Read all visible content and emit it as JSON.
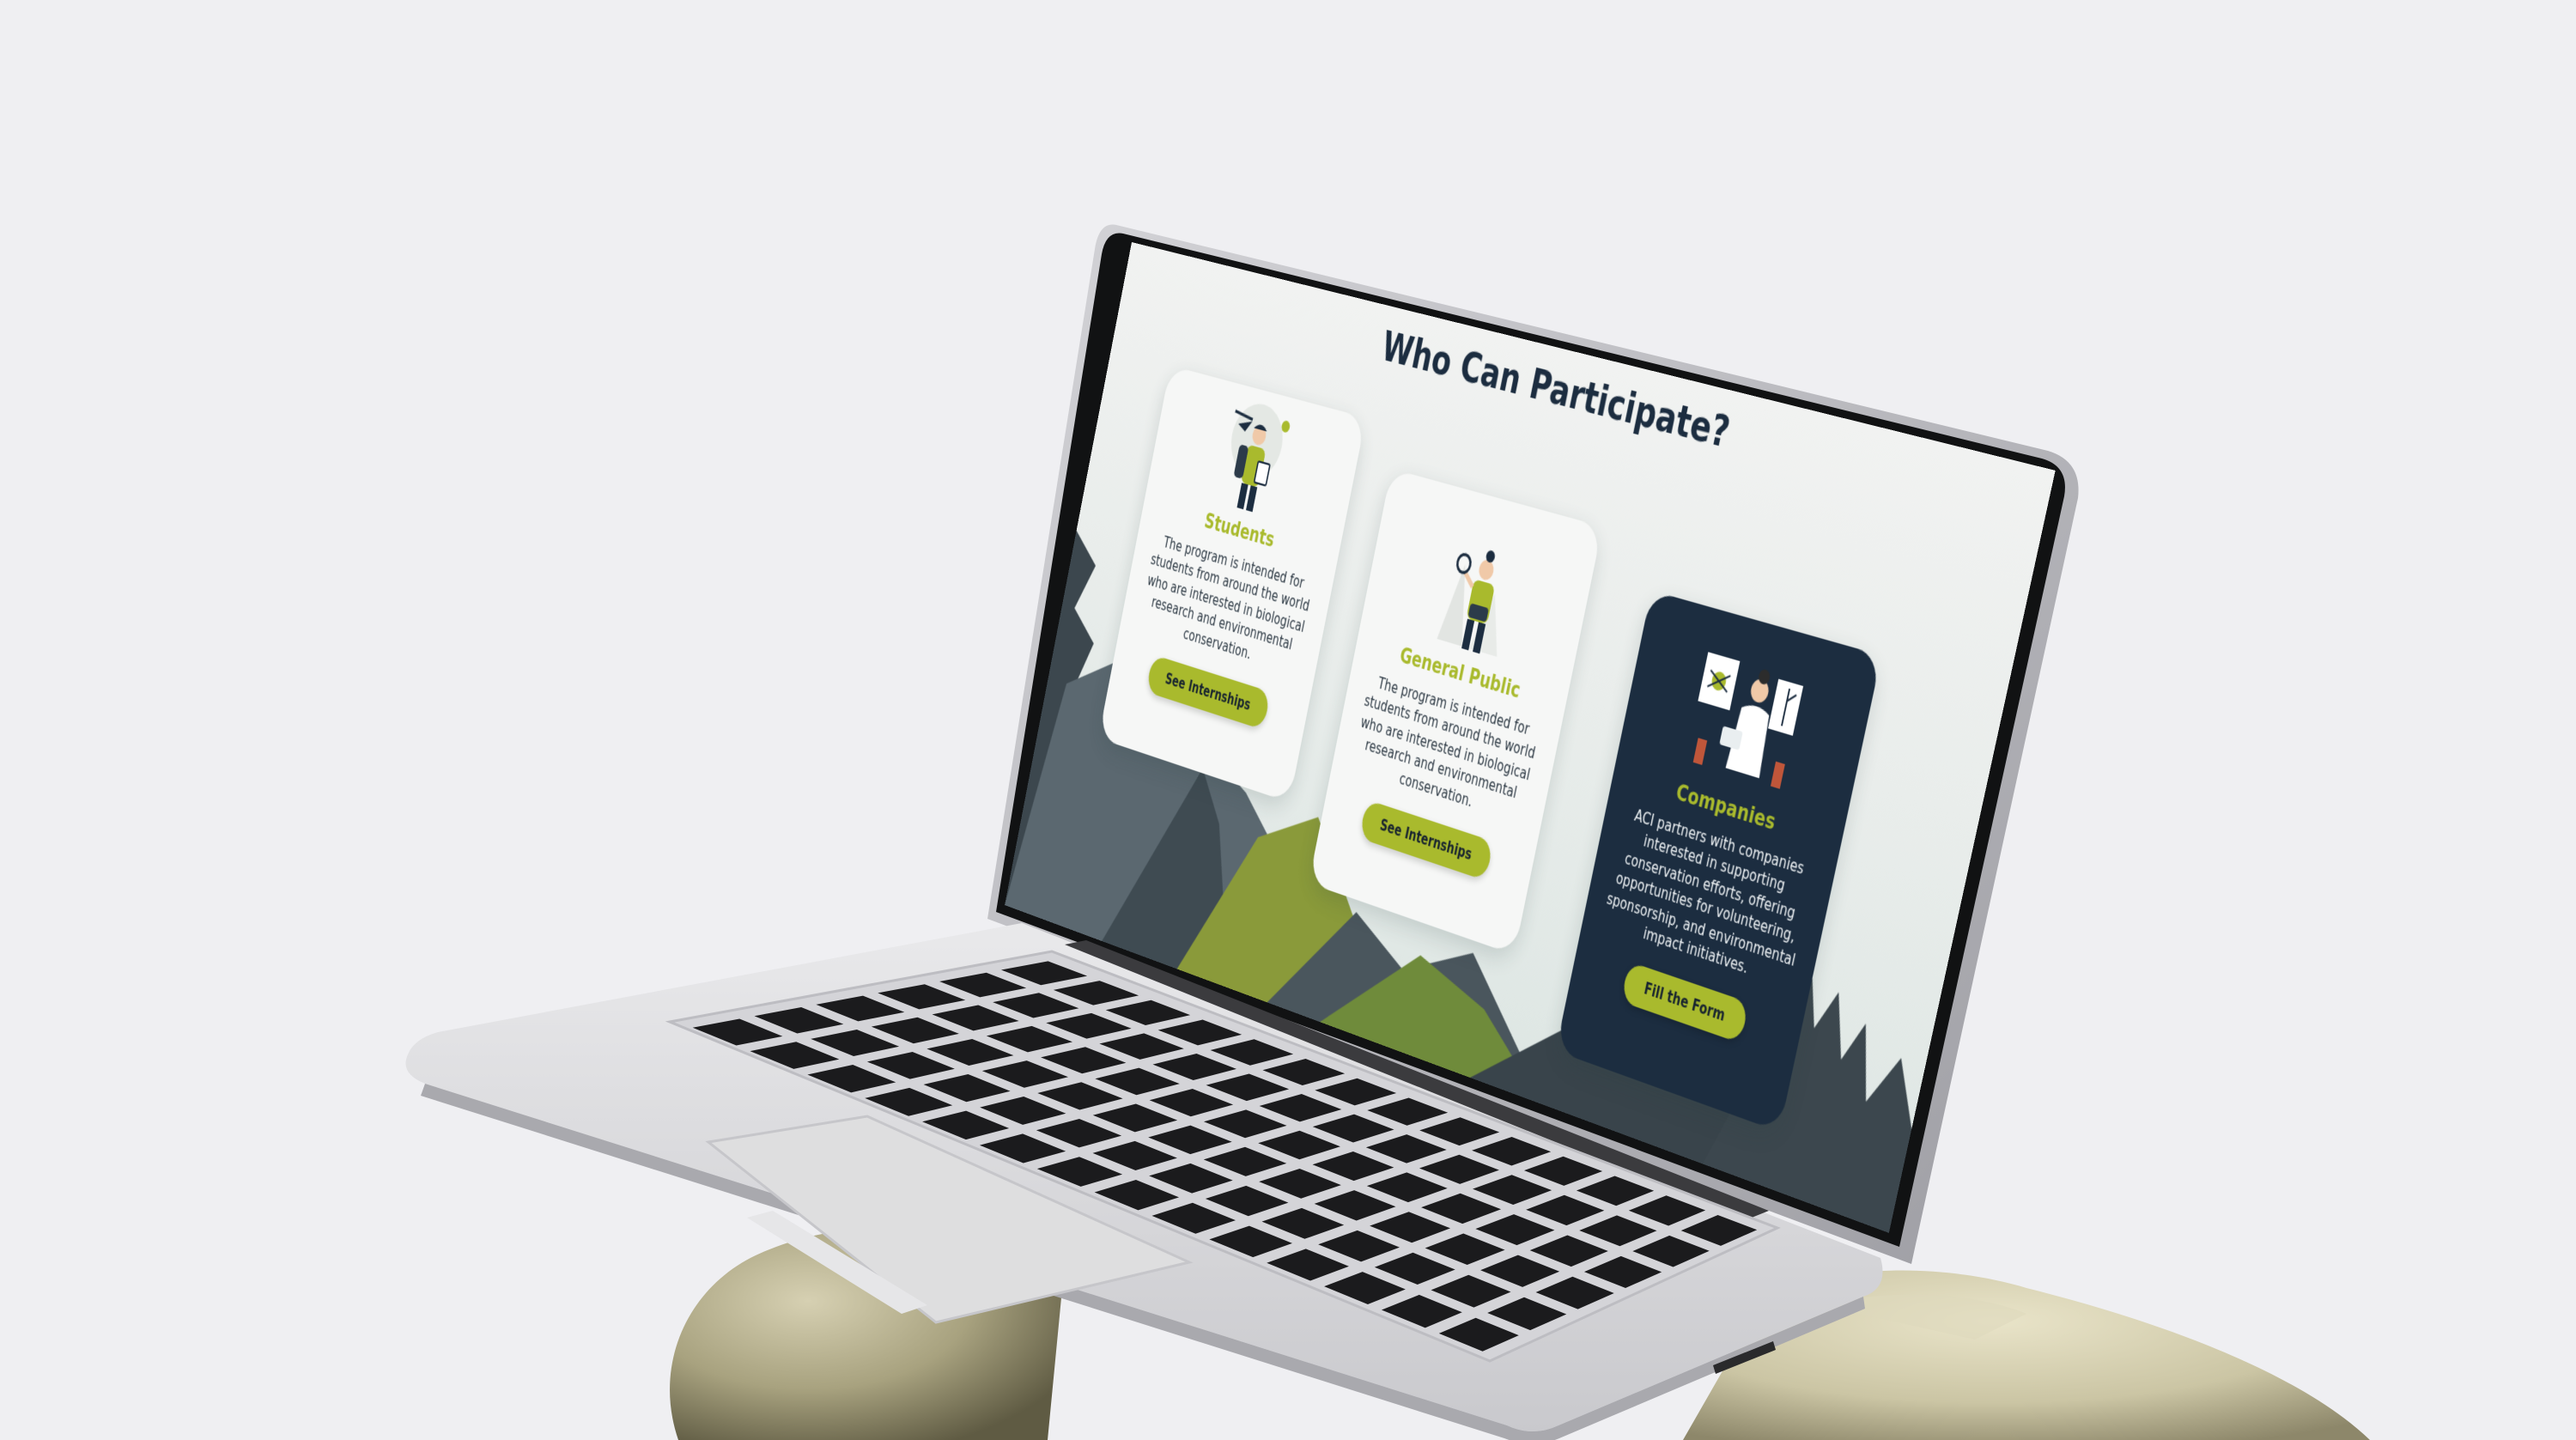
{
  "page": {
    "heading": "Who Can Participate?"
  },
  "cards": [
    {
      "title": "Students",
      "description": "The program is intended for students from around the world who are interested in biological research and environmental conservation.",
      "button_label": "See Internships"
    },
    {
      "title": "General Public",
      "description": "The program is intended for students from around the world who are interested in biological research and environmental conservation.",
      "button_label": "See Internships"
    },
    {
      "title": "Companies",
      "description": "ACI partners with companies interested in supporting conservation efforts, offering opportunities for volunteering, sponsorship, and environmental impact initiatives.",
      "button_label": "Fill the Form"
    }
  ],
  "theme": {
    "accent": "#a9ba2d",
    "navy": "#1c2d40",
    "mountain_dark": "#3c474e",
    "mountain_green": "#8a9a3a"
  }
}
